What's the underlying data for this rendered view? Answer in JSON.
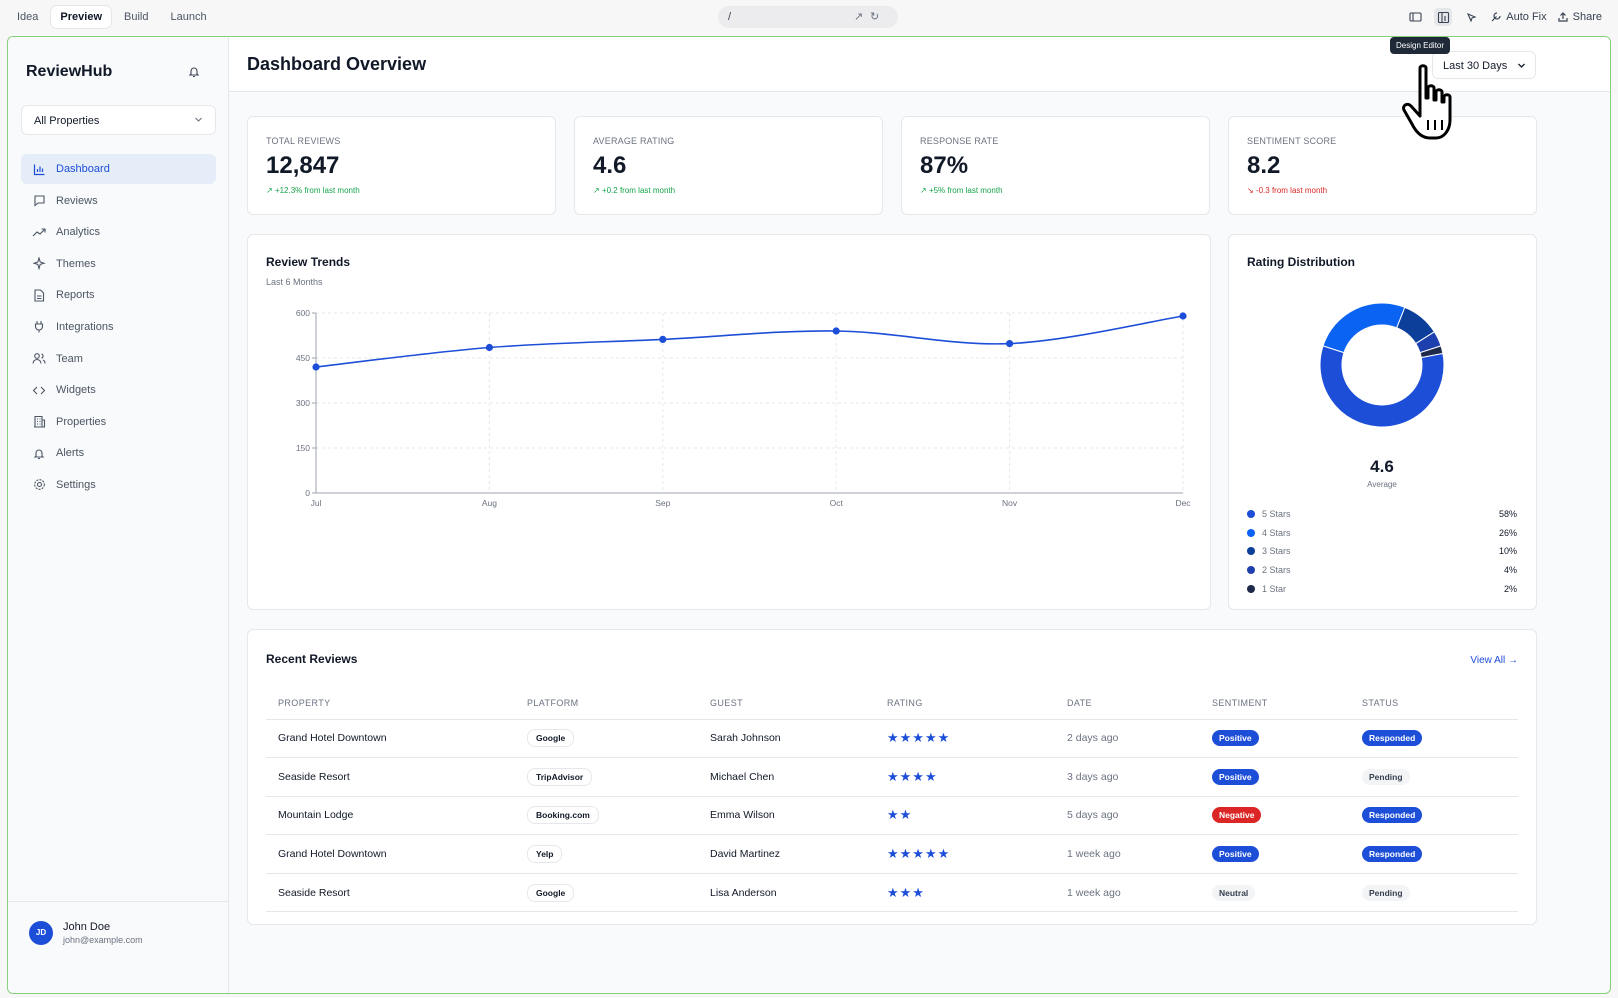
{
  "topbar": {
    "tabs": [
      "Idea",
      "Preview",
      "Build",
      "Launch"
    ],
    "active_tab": "Preview",
    "url_path": "/",
    "auto_fix": "Auto Fix",
    "share": "Share",
    "tooltip": "Design Editor"
  },
  "sidebar": {
    "brand": "ReviewHub",
    "property_select": "All Properties",
    "items": [
      {
        "label": "Dashboard",
        "icon": "bar-chart-icon",
        "active": true
      },
      {
        "label": "Reviews",
        "icon": "message-square-icon"
      },
      {
        "label": "Analytics",
        "icon": "trending-up-icon"
      },
      {
        "label": "Themes",
        "icon": "sparkles-icon"
      },
      {
        "label": "Reports",
        "icon": "file-text-icon"
      },
      {
        "label": "Integrations",
        "icon": "plug-icon"
      },
      {
        "label": "Team",
        "icon": "users-icon"
      },
      {
        "label": "Widgets",
        "icon": "code-icon"
      },
      {
        "label": "Properties",
        "icon": "building-icon"
      },
      {
        "label": "Alerts",
        "icon": "bell-icon"
      },
      {
        "label": "Settings",
        "icon": "gear-icon"
      }
    ],
    "user": {
      "initials": "JD",
      "name": "John Doe",
      "email": "john@example.com"
    }
  },
  "header": {
    "title": "Dashboard Overview",
    "range": "Last 30 Days"
  },
  "stats": [
    {
      "label": "TOTAL REVIEWS",
      "value": "12,847",
      "delta": "+12.3% from last month",
      "trend": "up"
    },
    {
      "label": "AVERAGE RATING",
      "value": "4.6",
      "delta": "+0.2 from last month",
      "trend": "up"
    },
    {
      "label": "RESPONSE RATE",
      "value": "87%",
      "delta": "+5% from last month",
      "trend": "up"
    },
    {
      "label": "SENTIMENT SCORE",
      "value": "8.2",
      "delta": "-0.3 from last month",
      "trend": "down"
    }
  ],
  "trends": {
    "title": "Review Trends",
    "subtitle": "Last 6 Months"
  },
  "distribution": {
    "title": "Rating Distribution",
    "average": "4.6",
    "average_label": "Average"
  },
  "chart_data": [
    {
      "type": "line",
      "title": "Review Trends",
      "x": [
        "Jul",
        "Aug",
        "Sep",
        "Oct",
        "Nov",
        "Dec"
      ],
      "values": [
        420,
        485,
        512,
        540,
        498,
        590
      ],
      "ylim": [
        0,
        600
      ],
      "yticks": [
        0,
        150,
        300,
        450,
        600
      ],
      "grid": true,
      "color": "#1d4ed8"
    },
    {
      "type": "pie",
      "title": "Rating Distribution",
      "labels": [
        "5 Stars",
        "4 Stars",
        "3 Stars",
        "2 Stars",
        "1 Star"
      ],
      "values": [
        58,
        26,
        10,
        4,
        2
      ],
      "value_labels": [
        "58%",
        "26%",
        "10%",
        "4%",
        "2%"
      ],
      "colors": [
        "#1d4ed8",
        "#0b63f3",
        "#0b3f9a",
        "#1e40af",
        "#1e2a4a"
      ]
    }
  ],
  "reviews": {
    "title": "Recent Reviews",
    "view_all": "View All",
    "columns": [
      "PROPERTY",
      "PLATFORM",
      "GUEST",
      "RATING",
      "DATE",
      "SENTIMENT",
      "STATUS"
    ],
    "rows": [
      {
        "property": "Grand Hotel Downtown",
        "platform": "Google",
        "guest": "Sarah Johnson",
        "rating": 5,
        "date": "2 days ago",
        "sentiment": "Positive",
        "status": "Responded"
      },
      {
        "property": "Seaside Resort",
        "platform": "TripAdvisor",
        "guest": "Michael Chen",
        "rating": 4,
        "date": "3 days ago",
        "sentiment": "Positive",
        "status": "Pending"
      },
      {
        "property": "Mountain Lodge",
        "platform": "Booking.com",
        "guest": "Emma Wilson",
        "rating": 2,
        "date": "5 days ago",
        "sentiment": "Negative",
        "status": "Responded"
      },
      {
        "property": "Grand Hotel Downtown",
        "platform": "Yelp",
        "guest": "David Martinez",
        "rating": 5,
        "date": "1 week ago",
        "sentiment": "Positive",
        "status": "Responded"
      },
      {
        "property": "Seaside Resort",
        "platform": "Google",
        "guest": "Lisa Anderson",
        "rating": 3,
        "date": "1 week ago",
        "sentiment": "Neutral",
        "status": "Pending"
      }
    ]
  }
}
